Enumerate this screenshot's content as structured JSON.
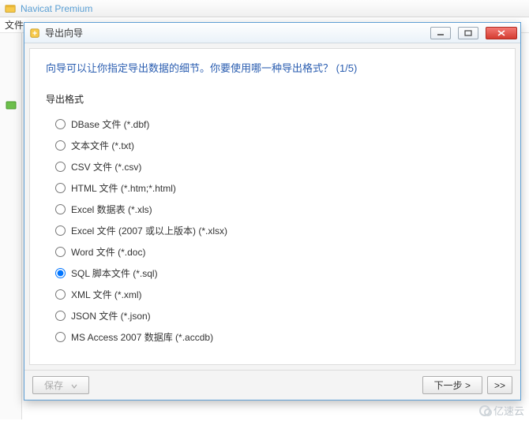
{
  "app": {
    "title": "Navicat Premium",
    "menu_first_fragment": "文件"
  },
  "dialog": {
    "title": "导出向导",
    "prompt": "向导可以让你指定导出数据的细节。你要使用哪一种导出格式？ (1/5)",
    "group_label": "导出格式",
    "formats": [
      {
        "label": "DBase 文件 (*.dbf)",
        "selected": false
      },
      {
        "label": "文本文件 (*.txt)",
        "selected": false
      },
      {
        "label": "CSV 文件 (*.csv)",
        "selected": false
      },
      {
        "label": "HTML 文件 (*.htm;*.html)",
        "selected": false
      },
      {
        "label": "Excel 数据表 (*.xls)",
        "selected": false
      },
      {
        "label": "Excel 文件 (2007 或以上版本) (*.xlsx)",
        "selected": false
      },
      {
        "label": "Word 文件 (*.doc)",
        "selected": false
      },
      {
        "label": "SQL 脚本文件 (*.sql)",
        "selected": true
      },
      {
        "label": "XML 文件 (*.xml)",
        "selected": false
      },
      {
        "label": "JSON 文件 (*.json)",
        "selected": false
      },
      {
        "label": "MS Access 2007 数据库 (*.accdb)",
        "selected": false
      }
    ],
    "buttons": {
      "save": "保存",
      "next": "下一步 >",
      "last": ">>"
    }
  },
  "watermark": "亿速云"
}
